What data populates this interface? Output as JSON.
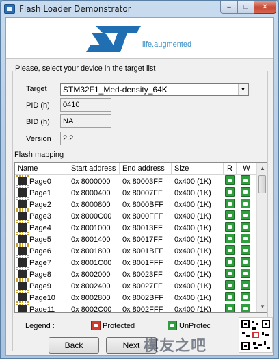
{
  "window": {
    "title": "Flash Loader Demonstrator",
    "close_glyph": "✕",
    "minimize_glyph": "–",
    "maximize_glyph": "□"
  },
  "banner": {
    "tagline": "life.augmented",
    "logo": "st-logo"
  },
  "instruction": "Please, select your device in the target list",
  "target": {
    "label": "Target",
    "value": "STM32F1_Med-density_64K"
  },
  "pid": {
    "label": "PID  (h)",
    "value": "0410"
  },
  "bid": {
    "label": "BID  (h)",
    "value": "NA"
  },
  "version": {
    "label": "Version",
    "value": "2.2"
  },
  "mapping": {
    "title": "Flash mapping",
    "columns": [
      "Name",
      "Start address",
      "End address",
      "Size",
      "R",
      "W"
    ],
    "rows": [
      {
        "name": "Page0",
        "start": "0x 8000000",
        "end": "0x 80003FF",
        "size": "0x400 (1K)"
      },
      {
        "name": "Page1",
        "start": "0x 8000400",
        "end": "0x 80007FF",
        "size": "0x400 (1K)"
      },
      {
        "name": "Page2",
        "start": "0x 8000800",
        "end": "0x 8000BFF",
        "size": "0x400 (1K)"
      },
      {
        "name": "Page3",
        "start": "0x 8000C00",
        "end": "0x 8000FFF",
        "size": "0x400 (1K)"
      },
      {
        "name": "Page4",
        "start": "0x 8001000",
        "end": "0x 80013FF",
        "size": "0x400 (1K)"
      },
      {
        "name": "Page5",
        "start": "0x 8001400",
        "end": "0x 80017FF",
        "size": "0x400 (1K)"
      },
      {
        "name": "Page6",
        "start": "0x 8001800",
        "end": "0x 8001BFF",
        "size": "0x400 (1K)"
      },
      {
        "name": "Page7",
        "start": "0x 8001C00",
        "end": "0x 8001FFF",
        "size": "0x400 (1K)"
      },
      {
        "name": "Page8",
        "start": "0x 8002000",
        "end": "0x 80023FF",
        "size": "0x400 (1K)"
      },
      {
        "name": "Page9",
        "start": "0x 8002400",
        "end": "0x 80027FF",
        "size": "0x400 (1K)"
      },
      {
        "name": "Page10",
        "start": "0x 8002800",
        "end": "0x 8002BFF",
        "size": "0x400 (1K)"
      },
      {
        "name": "Page11",
        "start": "0x 8002C00",
        "end": "0x 8002FFF",
        "size": "0x400 (1K)"
      }
    ],
    "row_state": "unprotected"
  },
  "legend": {
    "label": "Legend :",
    "protected": "Protected",
    "unprotected": "UnProtec"
  },
  "buttons": {
    "back": "Back",
    "next": "Next"
  },
  "colors": {
    "protected": "#d23a2c",
    "unprotected": "#2f9e3c",
    "st_blue": "#3d8fc8"
  },
  "watermark": {
    "text": "模友之吧"
  }
}
